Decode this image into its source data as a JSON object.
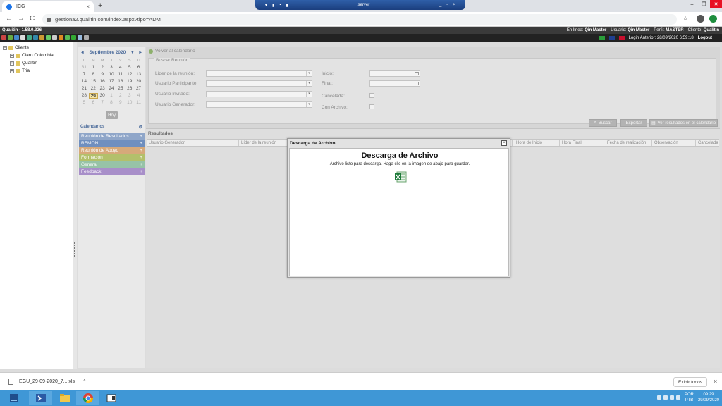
{
  "browser": {
    "tab_title": "ICG",
    "tab_close": "×",
    "new_tab": "+",
    "url": "gestiona2.qualitin.com/index.aspx?tipo=ADM",
    "remote_title": "server",
    "back": "←",
    "forward": "→",
    "reload": "C",
    "star": "☆"
  },
  "app": {
    "version": "Qualitin - 1.58.0.326",
    "header": {
      "online_label": "En línea:",
      "online_value": "Qin Master",
      "user_label": "Usuario:",
      "user_value": "Qin Master",
      "profile_label": "Perfil:",
      "profile_value": "MASTER",
      "client_label": "Cliente:",
      "client_value": "Qualitin"
    },
    "last_login": "Login Anterior: 28/09/2020 6:59:18",
    "logout": "Logout"
  },
  "tree": {
    "root": "Cliente",
    "children": [
      "Claro Colombia",
      "Qualitin",
      "Trial"
    ]
  },
  "calendar": {
    "prev": "◂",
    "next": "▸",
    "month": "Septiembre 2020",
    "dropdown": "▾",
    "dow": [
      "L",
      "M",
      "M",
      "J",
      "V",
      "S",
      "D"
    ],
    "weeks": [
      [
        "31",
        "1",
        "2",
        "3",
        "4",
        "5",
        "6"
      ],
      [
        "7",
        "8",
        "9",
        "10",
        "11",
        "12",
        "13"
      ],
      [
        "14",
        "15",
        "16",
        "17",
        "18",
        "19",
        "20"
      ],
      [
        "21",
        "22",
        "23",
        "24",
        "25",
        "26",
        "27"
      ],
      [
        "28",
        "29",
        "30",
        "1",
        "2",
        "3",
        "4"
      ],
      [
        "5",
        "6",
        "7",
        "8",
        "9",
        "10",
        "11"
      ]
    ],
    "today_button": "Hoy",
    "section_title": "Calendarios",
    "section_icon": "⚙",
    "items": [
      {
        "label": "Reunión de Resultados",
        "color": "#8fa6c9"
      },
      {
        "label": "REMON",
        "color": "#6f8fbf"
      },
      {
        "label": "Reunión de Apoyo",
        "color": "#d6a97a"
      },
      {
        "label": "Formación",
        "color": "#b3c06b"
      },
      {
        "label": "General",
        "color": "#97c3a7"
      },
      {
        "label": "Feedback",
        "color": "#a88fc9"
      }
    ],
    "item_plus": "+"
  },
  "main": {
    "back_link": "Volver al calendario",
    "search_legend": "Buscar Reunión",
    "labels": {
      "leader": "Líder de la reunión:",
      "participant": "Usuario Participante:",
      "invited": "Usuario Invitado:",
      "generator": "Usuario Generador:",
      "start": "Inicio:",
      "end": "Final:",
      "cancelled": "Cancelada:",
      "attachment": "Con Archivo:"
    },
    "dropdown_arrow": "▾",
    "buttons": {
      "search": "Buscar",
      "export": "Exportar",
      "view_calendar": "Ver resultados en el calendario"
    },
    "results_title": "Resultados",
    "columns": [
      "Usuario Generador",
      "Líder de la reunión",
      "Hora de Inicio",
      "Hora Final",
      "Fecha de realización",
      "Observación",
      "Cancelada"
    ]
  },
  "modal": {
    "title": "Descarga de Archivo",
    "heading": "Descarga de Archivo",
    "message": "Archivo listo para descarga. Haga clic en la imagen de abajo para guardar.",
    "close": "×"
  },
  "download": {
    "filename": "EGU_29-09-2020_7....xls",
    "chevron": "^",
    "show_all": "Exibir todos",
    "close": "×"
  },
  "taskbar": {
    "lang_top": "POR",
    "lang_bottom": "PTB",
    "time": "09:29",
    "date": "29/09/2020"
  }
}
